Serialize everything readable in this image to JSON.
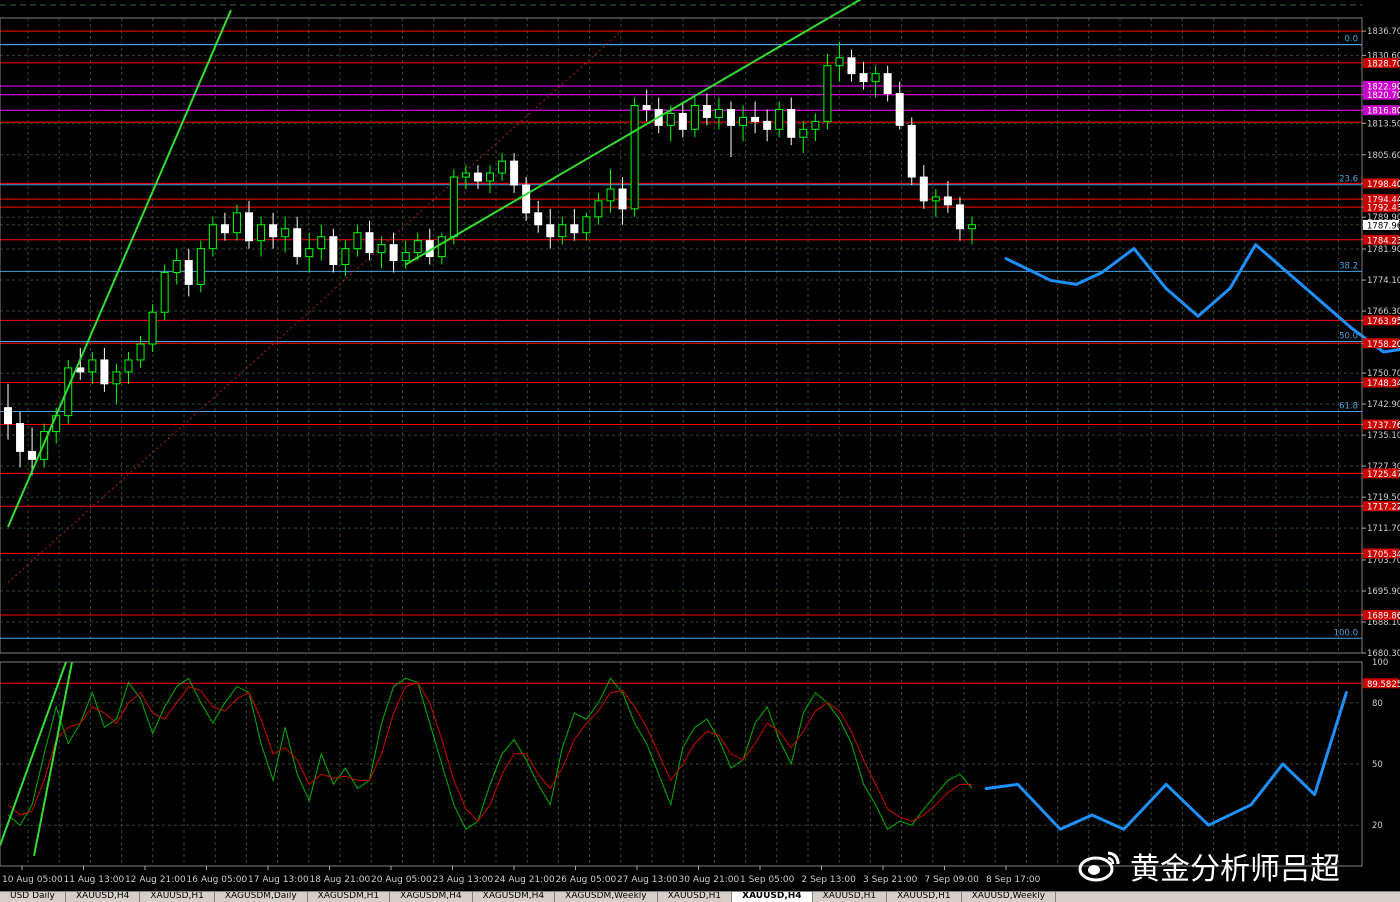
{
  "chart_data": [
    {
      "type": "candlestick",
      "symbol": "XAUUSD",
      "timeframe": "H4",
      "colors": {
        "up": "#00ff00",
        "down": "#ffffff",
        "background": "#000000",
        "grid": "#3a4a3a"
      },
      "ylim": [
        1680.3,
        1840.0
      ],
      "y_tick_labels": [
        "1836.70",
        "1830.60",
        "1822.90",
        "1820.70",
        "1816.80",
        "1813.50",
        "1805.60",
        "1798.40",
        "1794.44",
        "1792.43",
        "1789.90",
        "1787.96",
        "1784.23",
        "1781.90",
        "1774.10",
        "1766.30",
        "1763.95",
        "1758.20",
        "1750.70",
        "1748.34",
        "1742.90",
        "1737.76",
        "1735.10",
        "1727.30",
        "1725.47",
        "1719.50",
        "1717.22",
        "1711.70",
        "1705.34",
        "1703.70",
        "1695.90",
        "1689.86",
        "1688.10",
        "1680.30"
      ],
      "x_tick_labels": [
        "10 Aug 05:00",
        "11 Aug 13:00",
        "12 Aug 21:00",
        "16 Aug 05:00",
        "17 Aug 13:00",
        "18 Aug 21:00",
        "20 Aug 05:00",
        "23 Aug 13:00",
        "24 Aug 21:00",
        "26 Aug 05:00",
        "27 Aug 13:00",
        "30 Aug 21:00",
        "1 Sep 05:00",
        "2 Sep 13:00",
        "3 Sep 21:00",
        "7 Sep 09:00",
        "8 Sep 17:00"
      ],
      "horizontal_levels": [
        {
          "price": 1836.7,
          "color": "#ff0000",
          "label": ""
        },
        {
          "price": 1833.3,
          "color": "#4aa3df",
          "label": ""
        },
        {
          "price": 1828.7,
          "color": "#ff0000",
          "label": "1828.70"
        },
        {
          "price": 1822.9,
          "color": "#ff00ff",
          "label": "1822.90"
        },
        {
          "price": 1820.7,
          "color": "#ff00ff",
          "label": "1820.70"
        },
        {
          "price": 1816.8,
          "color": "#ff00ff",
          "label": "1816.80"
        },
        {
          "price": 1813.8,
          "color": "#ff0000",
          "label": ""
        },
        {
          "price": 1798.4,
          "color": "#ff0000",
          "label": "1798.40"
        },
        {
          "price": 1794.44,
          "color": "#ff0000",
          "label": "1794.44"
        },
        {
          "price": 1792.43,
          "color": "#ff0000",
          "label": "1792.43"
        },
        {
          "price": 1784.23,
          "color": "#ff0000",
          "label": "1784.23"
        },
        {
          "price": 1763.95,
          "color": "#ff0000",
          "label": "1763.95"
        },
        {
          "price": 1758.2,
          "color": "#ff0000",
          "label": "1758.20"
        },
        {
          "price": 1748.34,
          "color": "#ff0000",
          "label": "1748.34"
        },
        {
          "price": 1737.76,
          "color": "#ff0000",
          "label": "1737.76"
        },
        {
          "price": 1725.47,
          "color": "#ff0000",
          "label": "1725.47"
        },
        {
          "price": 1717.22,
          "color": "#ff0000",
          "label": "1717.22"
        },
        {
          "price": 1705.34,
          "color": "#ff0000",
          "label": "1705.34"
        },
        {
          "price": 1689.86,
          "color": "#ff0000",
          "label": "1689.86"
        }
      ],
      "fibonacci": {
        "high": 1833.3,
        "low": 1684.0,
        "color": "#4aa3df",
        "levels": [
          {
            "ratio": 0.0,
            "label": "0.0"
          },
          {
            "ratio": 0.236,
            "label": "23.6"
          },
          {
            "ratio": 0.382,
            "label": "38.2"
          },
          {
            "ratio": 0.5,
            "label": "50.0"
          },
          {
            "ratio": 0.618,
            "label": "61.8"
          },
          {
            "ratio": 1.0,
            "label": "100.0"
          }
        ]
      },
      "current_price": "1787.96",
      "candles": [
        [
          1742,
          1748,
          1734,
          1738
        ],
        [
          1738,
          1741,
          1727,
          1731
        ],
        [
          1731,
          1737,
          1725,
          1729
        ],
        [
          1729,
          1738,
          1727,
          1736
        ],
        [
          1736,
          1742,
          1733,
          1740
        ],
        [
          1740,
          1754,
          1738,
          1752
        ],
        [
          1752,
          1757,
          1749,
          1751
        ],
        [
          1751,
          1756,
          1748,
          1754
        ],
        [
          1754,
          1757,
          1746,
          1748
        ],
        [
          1748,
          1753,
          1743,
          1751
        ],
        [
          1751,
          1756,
          1748,
          1754
        ],
        [
          1754,
          1760,
          1752,
          1758
        ],
        [
          1758,
          1768,
          1756,
          1766
        ],
        [
          1766,
          1778,
          1764,
          1776
        ],
        [
          1776,
          1782,
          1773,
          1779
        ],
        [
          1779,
          1782,
          1770,
          1773
        ],
        [
          1773,
          1784,
          1771,
          1782
        ],
        [
          1782,
          1790,
          1780,
          1788
        ],
        [
          1788,
          1791,
          1784,
          1786
        ],
        [
          1786,
          1793,
          1784,
          1791
        ],
        [
          1791,
          1794,
          1782,
          1784
        ],
        [
          1784,
          1790,
          1780,
          1788
        ],
        [
          1788,
          1791,
          1782,
          1785
        ],
        [
          1785,
          1790,
          1781,
          1787
        ],
        [
          1787,
          1790,
          1778,
          1780
        ],
        [
          1780,
          1786,
          1776,
          1782
        ],
        [
          1782,
          1788,
          1779,
          1785
        ],
        [
          1785,
          1787,
          1776,
          1778
        ],
        [
          1778,
          1784,
          1775,
          1782
        ],
        [
          1782,
          1788,
          1780,
          1786
        ],
        [
          1786,
          1789,
          1779,
          1781
        ],
        [
          1781,
          1785,
          1777,
          1783
        ],
        [
          1783,
          1786,
          1776,
          1779
        ],
        [
          1779,
          1784,
          1777,
          1781
        ],
        [
          1781,
          1786,
          1779,
          1784
        ],
        [
          1784,
          1787,
          1778,
          1780
        ],
        [
          1780,
          1786,
          1778,
          1785
        ],
        [
          1785,
          1802,
          1783,
          1800
        ],
        [
          1800,
          1803,
          1797,
          1801
        ],
        [
          1801,
          1803,
          1797,
          1799
        ],
        [
          1799,
          1803,
          1796,
          1801
        ],
        [
          1801,
          1806,
          1799,
          1804
        ],
        [
          1804,
          1806,
          1796,
          1798
        ],
        [
          1798,
          1800,
          1789,
          1791
        ],
        [
          1791,
          1794,
          1786,
          1788
        ],
        [
          1788,
          1792,
          1782,
          1785
        ],
        [
          1785,
          1790,
          1783,
          1788
        ],
        [
          1788,
          1792,
          1784,
          1786
        ],
        [
          1786,
          1791,
          1784,
          1790
        ],
        [
          1790,
          1796,
          1788,
          1794
        ],
        [
          1794,
          1802,
          1791,
          1797
        ],
        [
          1797,
          1800,
          1788,
          1792
        ],
        [
          1792,
          1820,
          1790,
          1818
        ],
        [
          1818,
          1822,
          1814,
          1817
        ],
        [
          1817,
          1820,
          1811,
          1813
        ],
        [
          1813,
          1818,
          1809,
          1816
        ],
        [
          1816,
          1819,
          1810,
          1812
        ],
        [
          1812,
          1820,
          1810,
          1818
        ],
        [
          1818,
          1821,
          1813,
          1815
        ],
        [
          1815,
          1820,
          1812,
          1817
        ],
        [
          1817,
          1819,
          1805,
          1813
        ],
        [
          1813,
          1818,
          1809,
          1815
        ],
        [
          1815,
          1819,
          1811,
          1814
        ],
        [
          1814,
          1817,
          1809,
          1812
        ],
        [
          1812,
          1819,
          1810,
          1817
        ],
        [
          1817,
          1820,
          1808,
          1810
        ],
        [
          1810,
          1814,
          1806,
          1812
        ],
        [
          1812,
          1816,
          1809,
          1814
        ],
        [
          1814,
          1831,
          1812,
          1828
        ],
        [
          1828,
          1834,
          1824,
          1830
        ],
        [
          1830,
          1832,
          1824,
          1826
        ],
        [
          1826,
          1829,
          1822,
          1824
        ],
        [
          1824,
          1828,
          1820,
          1826
        ],
        [
          1826,
          1828,
          1819,
          1821
        ],
        [
          1821,
          1824,
          1812,
          1813
        ],
        [
          1813,
          1815,
          1798,
          1800
        ],
        [
          1800,
          1803,
          1792,
          1794
        ],
        [
          1794,
          1797,
          1790,
          1795
        ],
        [
          1795,
          1799,
          1791,
          1793
        ],
        [
          1793,
          1795,
          1784,
          1787
        ],
        [
          1787,
          1790,
          1783,
          1788
        ]
      ],
      "green_trendlines": [
        {
          "from": [
            0,
            1712
          ],
          "to": [
            18.5,
            1842
          ]
        },
        {
          "from": [
            33,
            1778
          ],
          "to": [
            71.5,
            1846
          ]
        }
      ],
      "dotted_trendline": {
        "from": [
          0,
          1698
        ],
        "to": [
          51,
          1837
        ]
      },
      "forecast_path": [
        [
          1793,
          1779.5
        ],
        [
          1800,
          1774
        ],
        [
          1804,
          1773
        ],
        [
          1808,
          1776
        ],
        [
          1813,
          1782
        ],
        [
          1818,
          1772
        ],
        [
          1823,
          1765
        ],
        [
          1828,
          1772
        ],
        [
          1832,
          1783
        ],
        [
          1837,
          1776
        ],
        [
          1842,
          1769
        ],
        [
          1847,
          1762
        ],
        [
          1852,
          1756
        ],
        [
          1856,
          1757
        ],
        [
          1861,
          1765
        ],
        [
          1866,
          1773
        ],
        [
          1871,
          1777
        ],
        [
          1876,
          1771
        ],
        [
          1881,
          1766
        ],
        [
          1886,
          1765
        ],
        [
          1891,
          1770
        ],
        [
          1896,
          1778
        ],
        [
          1901,
          1787
        ],
        [
          1905,
          1790
        ],
        [
          1910,
          1782
        ]
      ]
    },
    {
      "type": "line",
      "indicator": "Stochastic Oscillator",
      "ylim": [
        0,
        100
      ],
      "y_tick_labels": [
        "100",
        "80",
        "50",
        "20"
      ],
      "overbought_level": {
        "value": "89.5825",
        "color": "#ff0000"
      },
      "series": [
        {
          "color": "#00b000",
          "values": [
            25,
            20,
            30,
            55,
            78,
            60,
            70,
            85,
            68,
            72,
            90,
            82,
            65,
            78,
            88,
            92,
            80,
            70,
            80,
            88,
            85,
            60,
            42,
            68,
            45,
            32,
            55,
            40,
            48,
            38,
            42,
            70,
            88,
            92,
            90,
            70,
            50,
            30,
            18,
            22,
            40,
            55,
            62,
            52,
            40,
            30,
            58,
            75,
            72,
            80,
            92,
            85,
            70,
            60,
            45,
            30,
            58,
            68,
            72,
            62,
            48,
            52,
            70,
            78,
            62,
            50,
            75,
            85,
            80,
            72,
            60,
            40,
            30,
            18,
            22,
            20,
            28,
            35,
            42,
            45,
            38
          ]
        },
        {
          "color": "#cc0000",
          "values": [
            30,
            25,
            27,
            42,
            62,
            68,
            70,
            78,
            75,
            70,
            80,
            85,
            75,
            72,
            80,
            88,
            86,
            78,
            76,
            82,
            85,
            72,
            55,
            58,
            52,
            40,
            45,
            43,
            44,
            42,
            42,
            55,
            75,
            88,
            90,
            80,
            62,
            42,
            28,
            22,
            30,
            45,
            55,
            55,
            45,
            38,
            48,
            62,
            70,
            76,
            85,
            86,
            78,
            68,
            55,
            42,
            50,
            60,
            66,
            64,
            55,
            52,
            60,
            70,
            66,
            58,
            66,
            76,
            80,
            76,
            66,
            52,
            40,
            28,
            24,
            22,
            25,
            30,
            36,
            40,
            40
          ]
        }
      ],
      "forecast_path": [
        [
          0,
          38
        ],
        [
          3,
          40
        ],
        [
          7,
          18
        ],
        [
          10,
          25
        ],
        [
          13,
          18
        ],
        [
          17,
          40
        ],
        [
          21,
          20
        ],
        [
          25,
          30
        ],
        [
          28,
          50
        ],
        [
          31,
          35
        ],
        [
          34,
          85
        ]
      ]
    }
  ],
  "tabs": [
    "USD Daily",
    "XAUUSD,H4",
    "XAUUSD,H1",
    "XAGUSDM,Daily",
    "XAGUSDM,H1",
    "XAGUSDM,H4",
    "XAGUSDM,H4",
    "XAGUSDM,Weekly",
    "XAUUSD,H1",
    "XAUUSD,H4",
    "XAUUSD,H1",
    "XAUUSD,H1",
    "XAUUSD,Weekly"
  ],
  "active_tab_index": 9,
  "watermark": {
    "text": "黄金分析师吕超",
    "icon": "weibo-icon"
  }
}
